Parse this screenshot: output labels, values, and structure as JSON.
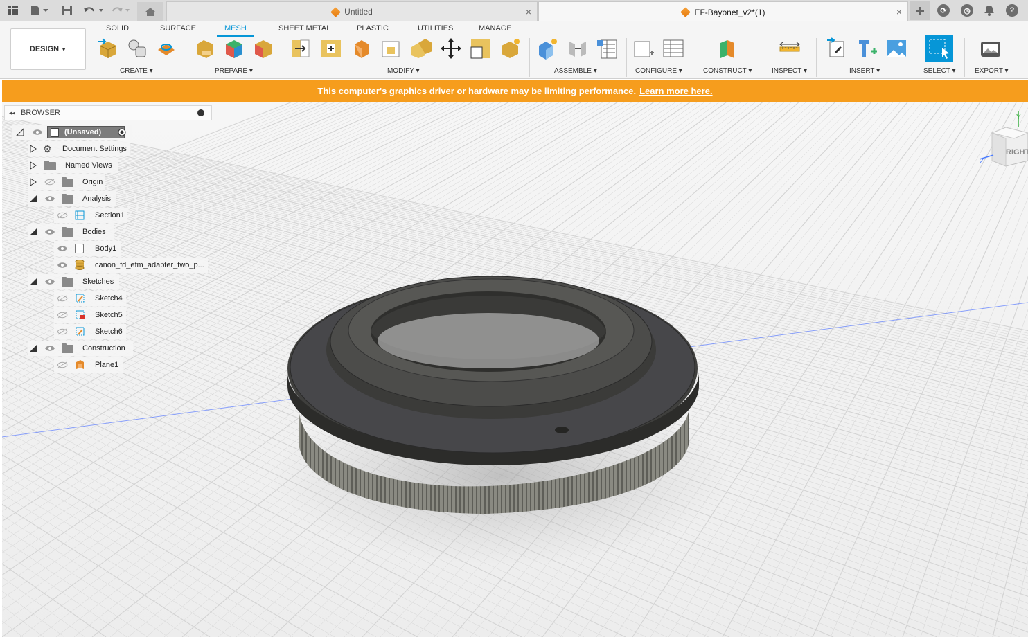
{
  "tabs": [
    {
      "label": "Untitled",
      "close": "×"
    },
    {
      "label": "EF-Bayonet_v2*(1)",
      "close": "×"
    }
  ],
  "toolbar": {
    "workspace": "DESIGN",
    "menu_tabs": [
      "SOLID",
      "SURFACE",
      "MESH",
      "SHEET METAL",
      "PLASTIC",
      "UTILITIES",
      "MANAGE"
    ],
    "active_tab": "MESH",
    "groups": [
      "CREATE",
      "PREPARE",
      "MODIFY",
      "ASSEMBLE",
      "CONFIGURE",
      "CONSTRUCT",
      "INSPECT",
      "INSERT",
      "SELECT",
      "EXPORT"
    ]
  },
  "banner": {
    "message": "This computer's graphics driver or hardware may be limiting performance.",
    "link": "Learn more here."
  },
  "browser": {
    "title": "BROWSER",
    "root": "(Unsaved)",
    "items": [
      {
        "label": "Document Settings"
      },
      {
        "label": "Named Views"
      },
      {
        "label": "Origin"
      },
      {
        "label": "Analysis"
      },
      {
        "label": "Section1"
      },
      {
        "label": "Bodies"
      },
      {
        "label": "Body1"
      },
      {
        "label": "canon_fd_efm_adapter_two_p..."
      },
      {
        "label": "Sketches"
      },
      {
        "label": "Sketch4"
      },
      {
        "label": "Sketch5"
      },
      {
        "label": "Sketch6"
      },
      {
        "label": "Construction"
      },
      {
        "label": "Plane1"
      }
    ]
  },
  "viewcube": {
    "face": "RIGHT",
    "axis_y": "Y",
    "axis_z": "Z"
  },
  "colors": {
    "accent": "#0696d7",
    "banner": "#f69d1d",
    "model": "#4a4a47"
  }
}
